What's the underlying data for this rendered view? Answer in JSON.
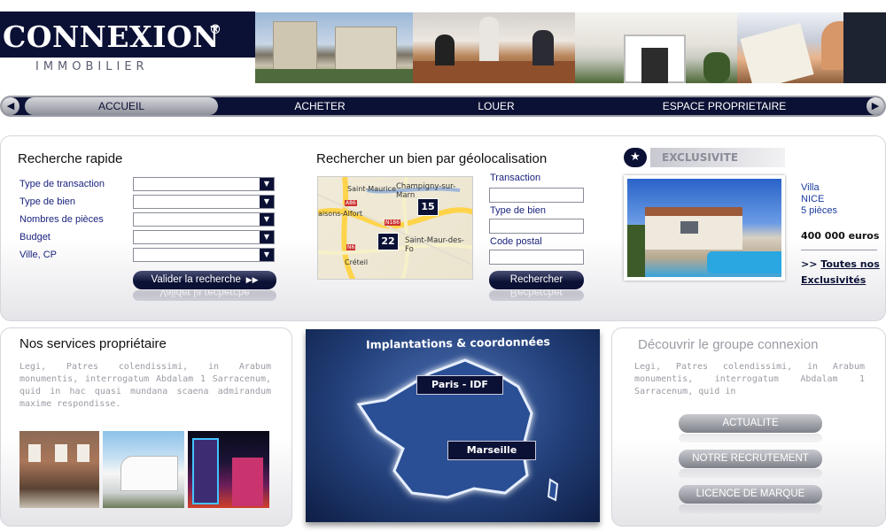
{
  "header": {
    "brand": "CONNEXION",
    "registered": "®",
    "subtitle": "IMMOBILIER"
  },
  "nav": {
    "items": [
      "ACCUEIL",
      "ACHETER",
      "LOUER",
      "ESPACE PROPRIETAIRE"
    ],
    "active": "ACCUEIL"
  },
  "quick_search": {
    "title": "Recherche rapide",
    "fields": [
      "Type de transaction",
      "Type de bien",
      "Nombres de pièces",
      "Budget",
      "Ville, CP"
    ],
    "submit_label": "Valider la recherche"
  },
  "geo_search": {
    "title": "Rechercher un bien par géolocalisation",
    "map_places": [
      "Saint-Maurice",
      "Champigny-sur-Marn",
      "aisons-Alfort",
      "Saint-Maur-des-Fo",
      "Créteil",
      "A86",
      "N186",
      "N6"
    ],
    "map_markers": [
      "15",
      "22"
    ],
    "fields": [
      "Transaction",
      "Type de bien",
      "Code postal"
    ],
    "submit_label": "Rechercher"
  },
  "exclusivity": {
    "title": "EXCLUSIVITE",
    "type": "Villa",
    "city": "NICE",
    "rooms": "5 pièces",
    "price": "400 000 euros",
    "link_prefix": ">>",
    "link_label": "Toutes nos Exclusivités"
  },
  "services": {
    "title": "Nos services propriétaire",
    "text": "Legi, Patres colendissimi, in Arabum monumentis, interrogatum Abdalam 1 Sarracenum, quid in hac quasi mundana scaena admirandum maxime respondisse."
  },
  "locations": {
    "title": "Implantations & coordonnées",
    "cities": [
      "Paris - IDF",
      "Marseille"
    ]
  },
  "group": {
    "title": "Découvrir le groupe connexion",
    "text": "Legi, Patres colendissimi, in Arabum monumentis, interrogatum Abdalam 1 Sarracenum, quid in",
    "buttons": [
      "ACTUALITE",
      "NOTRE RECRUTEMENT",
      "LICENCE DE MARQUE"
    ]
  },
  "colors": {
    "navy": "#0b1035",
    "link_blue": "#1a237e",
    "muted_gray": "#9a9ca4"
  }
}
